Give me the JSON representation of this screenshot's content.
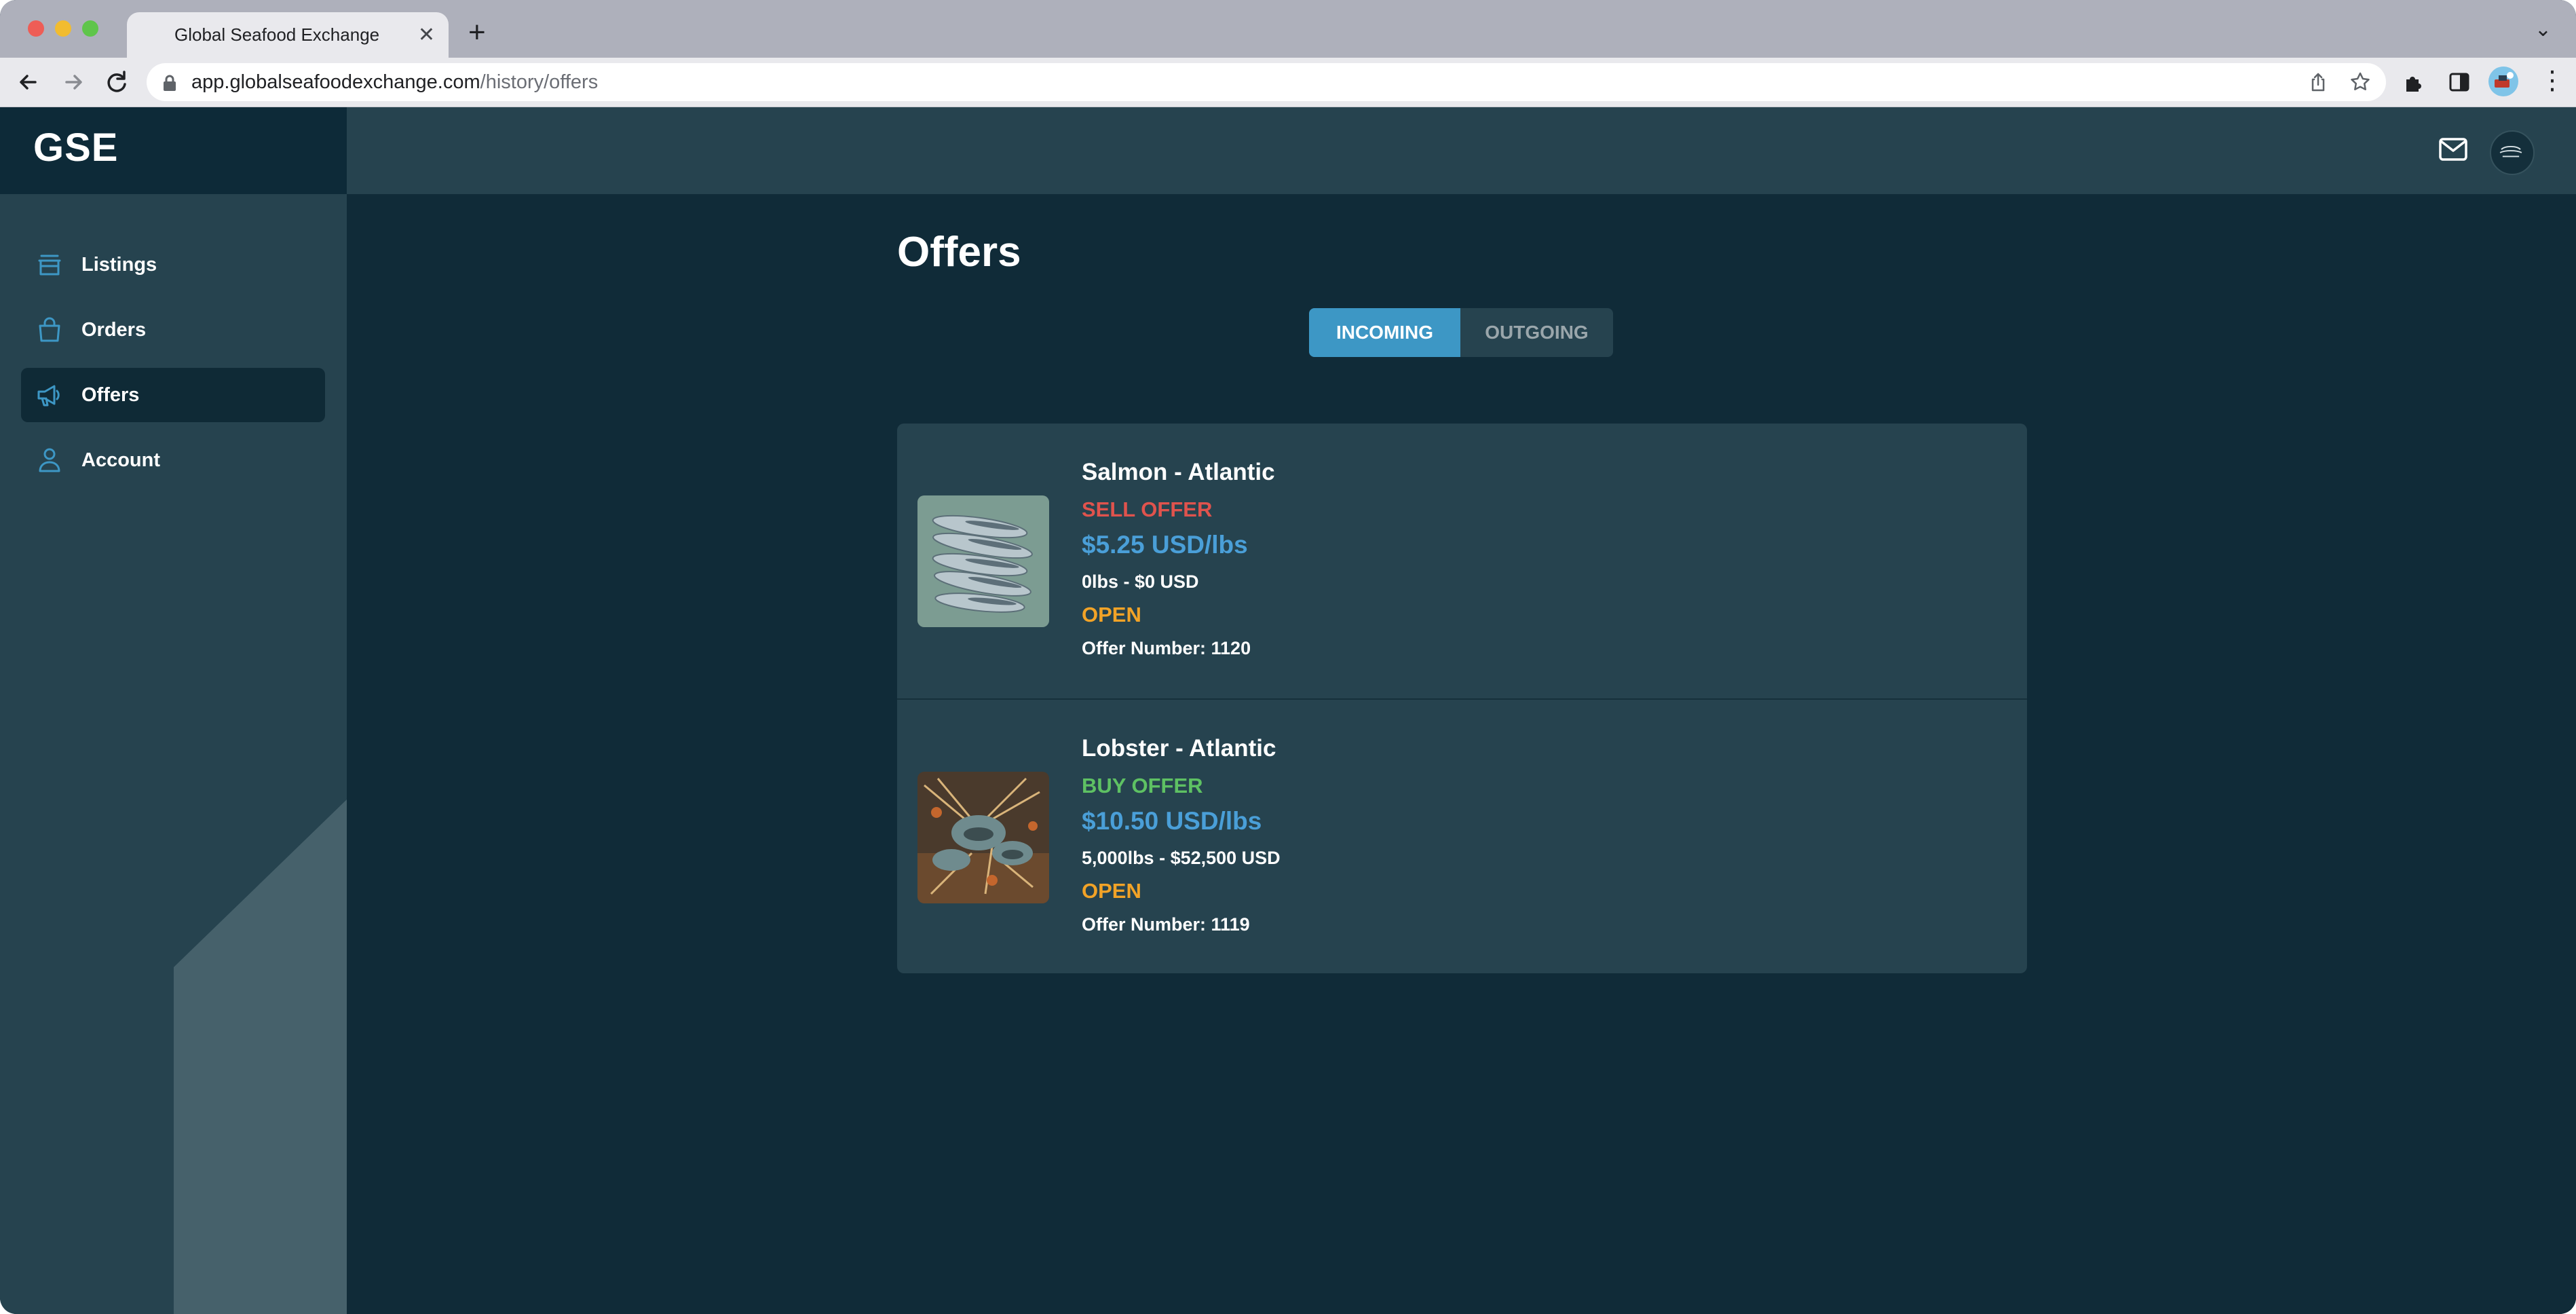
{
  "browser": {
    "tab_title": "Global Seafood Exchange",
    "tab_close": "✕",
    "new_tab": "+",
    "tab_menu": "⌄",
    "url_host": "app.globalseafoodexchange.com",
    "url_path": "/history/offers"
  },
  "sidebar": {
    "brand": "GSE",
    "items": [
      {
        "label": "Listings",
        "icon": "store-icon",
        "active": false
      },
      {
        "label": "Orders",
        "icon": "shopping-bag-icon",
        "active": false
      },
      {
        "label": "Offers",
        "icon": "megaphone-icon",
        "active": true
      },
      {
        "label": "Account",
        "icon": "user-icon",
        "active": false
      }
    ]
  },
  "topbar": {
    "icons": [
      "mail-icon",
      "avatar"
    ]
  },
  "main": {
    "title": "Offers",
    "tabs": {
      "incoming": "INCOMING",
      "outgoing": "OUTGOING",
      "selected": "incoming"
    },
    "offers": [
      {
        "name": "Salmon - Atlantic",
        "type": "SELL OFFER",
        "type_color": "#e0534d",
        "price": "$5.25 USD/lbs",
        "quantity": "0lbs - $0 USD",
        "status": "OPEN",
        "number": "Offer Number: 1120"
      },
      {
        "name": "Lobster - Atlantic",
        "type": "BUY OFFER",
        "type_color": "#5ec163",
        "price": "$10.50 USD/lbs",
        "quantity": "5,000lbs - $52,500 USD",
        "status": "OPEN",
        "number": "Offer Number: 1119"
      }
    ]
  },
  "colors": {
    "accent": "#3d97c5",
    "background": "#102b38",
    "panel": "#26434f",
    "price": "#4a9fd8",
    "status_open": "#f2a327"
  }
}
